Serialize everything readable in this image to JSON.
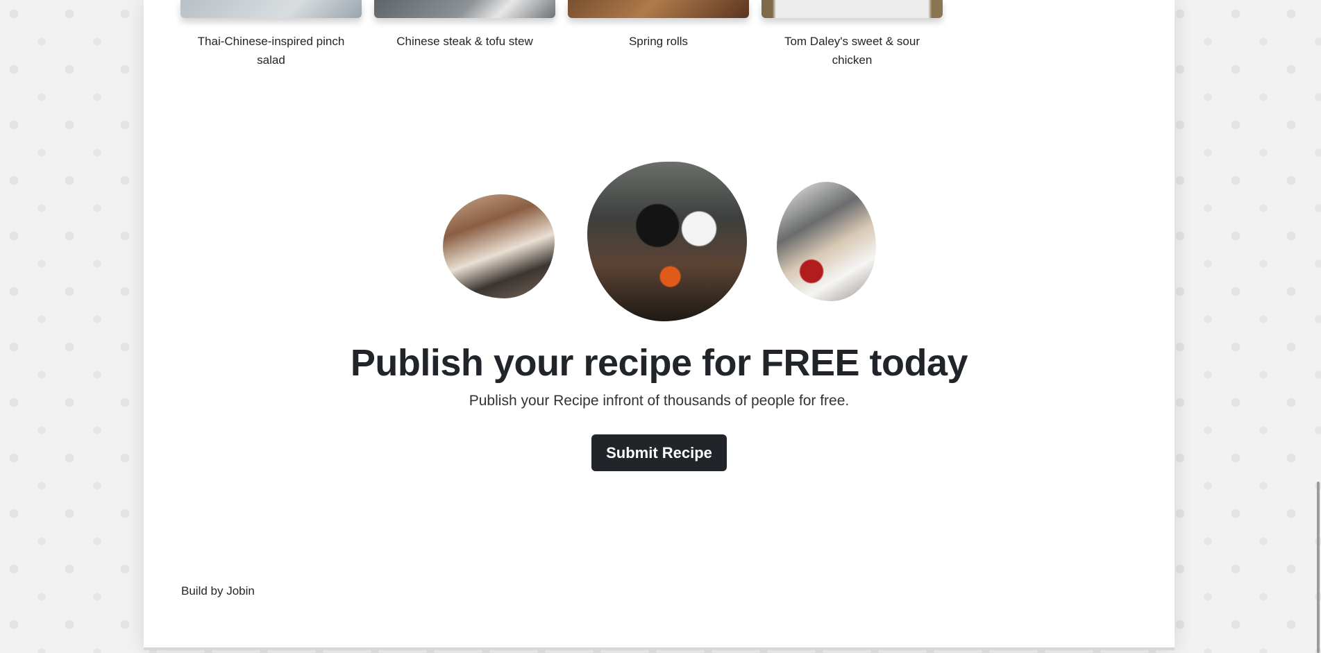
{
  "recipes": [
    {
      "title": "Thai-Chinese-inspired pinch salad"
    },
    {
      "title": "Chinese steak & tofu stew"
    },
    {
      "title": "Spring rolls"
    },
    {
      "title": "Tom Daley's sweet & sour chicken"
    }
  ],
  "cta": {
    "title": "Publish your recipe for FREE today",
    "subtitle": "Publish your Recipe infront of thousands of people for free.",
    "button_label": "Submit Recipe"
  },
  "footer": {
    "text": "Build by Jobin"
  },
  "colors": {
    "button_bg": "#212529",
    "text": "#212529",
    "page_bg": "#ffffff",
    "body_bg": "#f2f2f2"
  },
  "icons": [
    "food-pattern-background"
  ]
}
